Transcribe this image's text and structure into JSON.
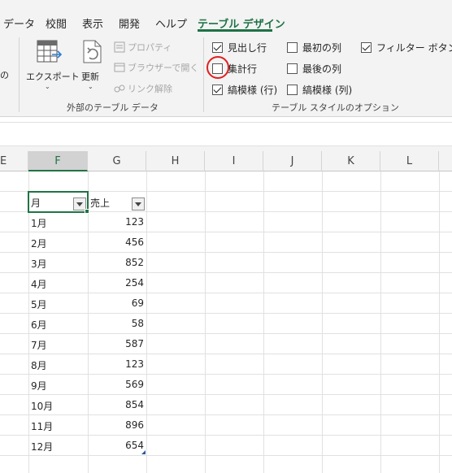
{
  "ribbon_tabs": [
    {
      "label": "データ"
    },
    {
      "label": "校閲"
    },
    {
      "label": "表示"
    },
    {
      "label": "開発"
    },
    {
      "label": "ヘルプ"
    },
    {
      "label": "テーブル デザイン",
      "active": true
    }
  ],
  "external_group": {
    "left_partial_label": "の",
    "export_label": "エクスポート",
    "refresh_label": "更新",
    "properties_label": "プロパティ",
    "open_in_browser_label": "ブラウザーで開く",
    "unlink_label": "リンク解除",
    "group_label": "外部のテーブル データ"
  },
  "style_options": {
    "header_row": {
      "label": "見出し行",
      "checked": true
    },
    "total_row": {
      "label": "集計行",
      "checked": false
    },
    "banded_rows": {
      "label": "縞模様 (行)",
      "checked": true
    },
    "first_column": {
      "label": "最初の列",
      "checked": false
    },
    "last_column": {
      "label": "最後の列",
      "checked": false
    },
    "banded_columns": {
      "label": "縞模様 (列)",
      "checked": false
    },
    "filter_button": {
      "label": "フィルター ボタン",
      "checked": true
    },
    "group_label": "テーブル スタイルのオプション"
  },
  "columns": [
    "E",
    "F",
    "G",
    "H",
    "I",
    "J",
    "K",
    "L"
  ],
  "selected_column": "F",
  "table": {
    "headers": {
      "month": "月",
      "sales": "売上"
    },
    "rows": [
      {
        "month": "1月",
        "sales": "123"
      },
      {
        "month": "2月",
        "sales": "456"
      },
      {
        "month": "3月",
        "sales": "852"
      },
      {
        "month": "4月",
        "sales": "254"
      },
      {
        "month": "5月",
        "sales": "69"
      },
      {
        "month": "6月",
        "sales": "58"
      },
      {
        "month": "7月",
        "sales": "587"
      },
      {
        "month": "8月",
        "sales": "123"
      },
      {
        "month": "9月",
        "sales": "569"
      },
      {
        "month": "10月",
        "sales": "854"
      },
      {
        "month": "11月",
        "sales": "896"
      },
      {
        "month": "12月",
        "sales": "654"
      }
    ]
  },
  "colors": {
    "accent": "#217346",
    "highlight": "#e02020"
  },
  "icons": [
    "export-table-icon",
    "refresh-icon",
    "properties-icon",
    "open-in-browser-icon",
    "unlink-icon",
    "filter-dropdown-icon"
  ]
}
